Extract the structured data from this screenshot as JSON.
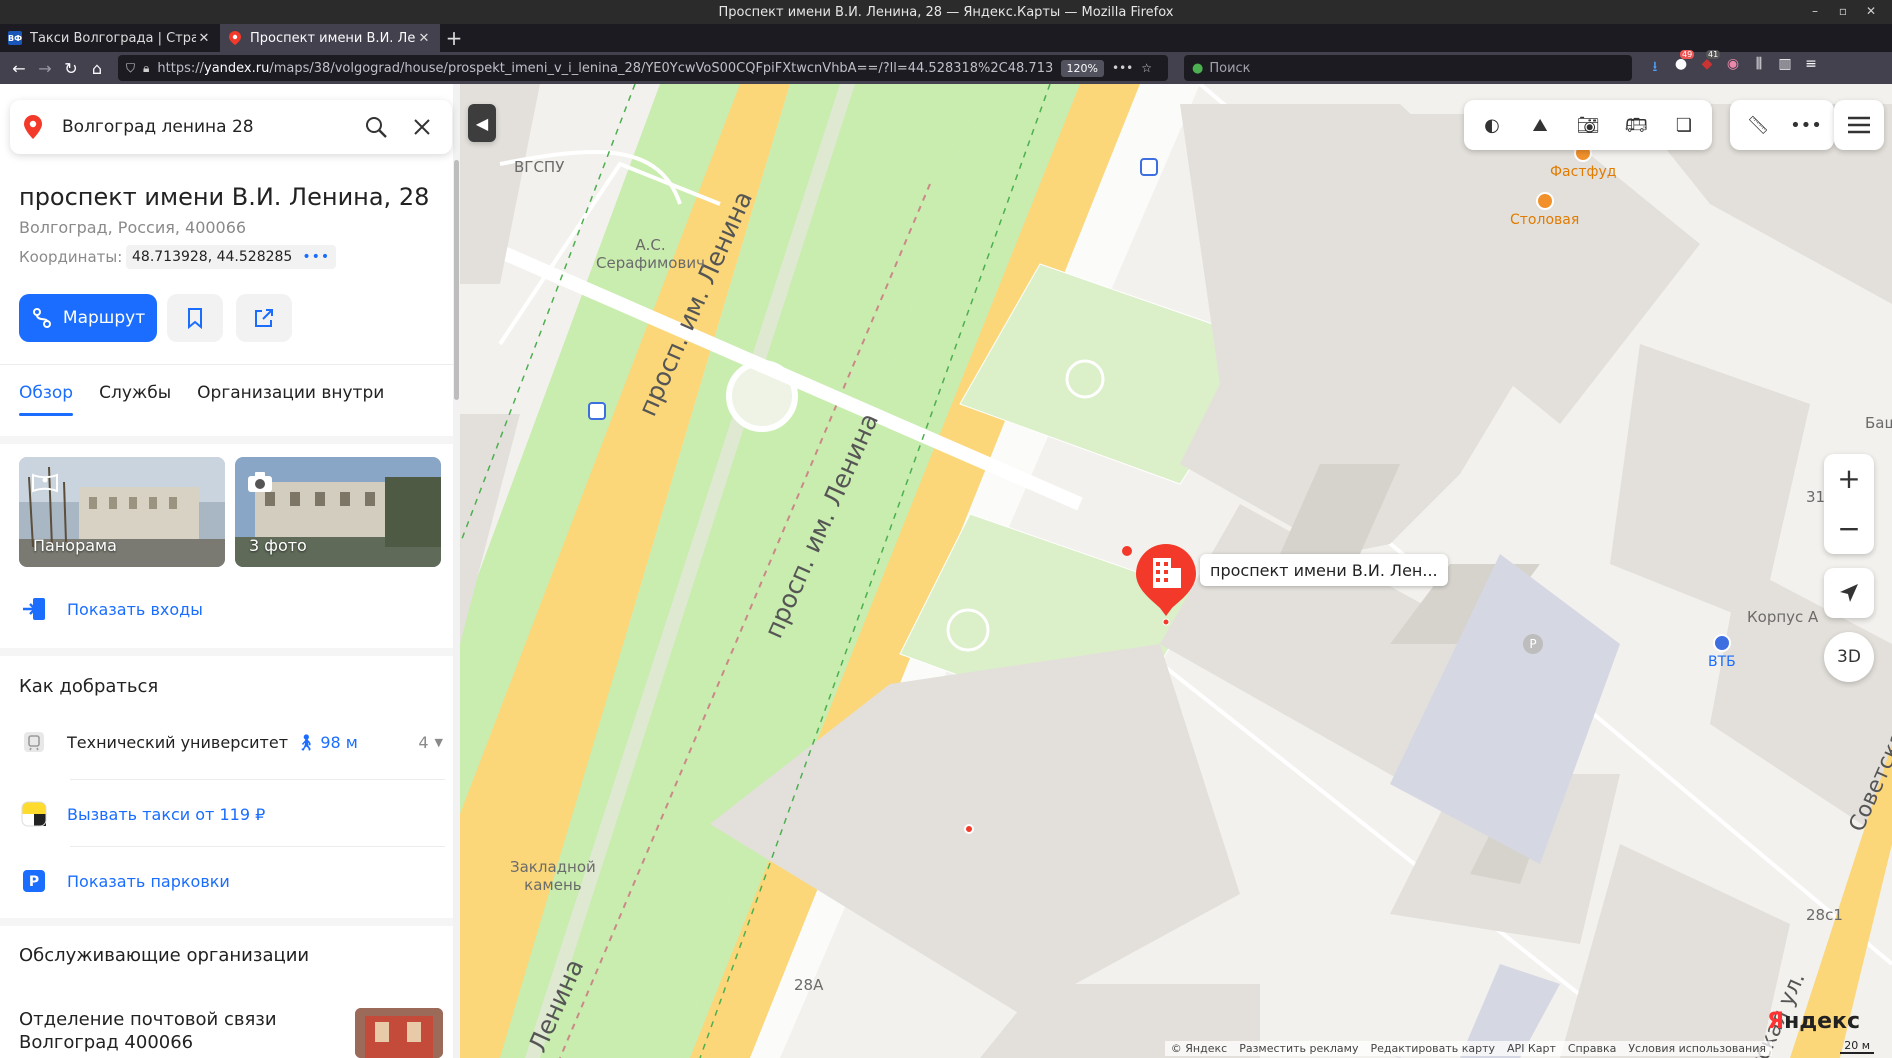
{
  "window": {
    "title": "Проспект имени В.И. Ленина, 28 — Яндекс.Карты — Mozilla Firefox"
  },
  "tabs": [
    {
      "label": "Такси Волгограда | Страни",
      "favicon": "ВФ"
    },
    {
      "label": "Проспект имени В.И. Лен",
      "favicon": ""
    }
  ],
  "nav": {
    "url_prefix": "https://",
    "url_host": "yandex.ru",
    "url_rest": "/maps/38/volgograd/house/prospekt_imeni_v_i_lenina_28/YE0YcwVoS00CQFpiFXtwcnVhbA==/?ll=44.528318%2C48.713",
    "zoom": "120%",
    "search_placeholder": "Поиск",
    "badge_1": "49",
    "badge_2": "41"
  },
  "sidebar": {
    "search_query": "Волгоград ленина 28",
    "place_title": "проспект имени В.И. Ленина, 28",
    "place_address": "Волгоград, Россия, 400066",
    "coords_label": "Координаты:",
    "coords_value": "48.713928, 44.528285",
    "route_button": "Маршрут",
    "tabs": [
      "Обзор",
      "Службы",
      "Организации внутри"
    ],
    "photos": [
      {
        "caption": "Панорама"
      },
      {
        "caption": "3 фото"
      }
    ],
    "show_entrances": "Показать входы",
    "how_to_get": "Как добраться",
    "transit_stop": "Технический университет",
    "transit_walk": "98 м",
    "transit_count": "4",
    "taxi": "Вызвать такси от 119 ₽",
    "parking": "Показать парковки",
    "service_orgs": "Обслуживающие организации",
    "org_name_line1": "Отделение почтовой связи",
    "org_name_line2": "Волгоград 400066"
  },
  "map": {
    "road_label_1": "просп. им. Ленина",
    "road_label_2": "просп. им. Ленина",
    "road_label_3": "Ленина",
    "road_label_4": "Советская",
    "road_label_5": "тская ул.",
    "label_vgspu": "ВГСПУ",
    "label_monument_1": "А.С.",
    "label_monument_2": "Серафимович",
    "label_stone_1": "Закладной",
    "label_stone_2": "камень",
    "label_fastfood": "Фастфуд",
    "label_canteen": "Столовая",
    "label_korpus": "Корпус А",
    "label_vtb": "ВТБ",
    "label_bash": "Баш",
    "label_31": "31",
    "label_28a": "28А",
    "label_28c1": "28с1",
    "pin_label": "проспект имени В.И. Лен...",
    "btn_3d": "3D",
    "logo": "Яндекс",
    "scale": "20 м",
    "footer": [
      "© Яндекс",
      "Разместить рекламу",
      "Редактировать карту",
      "API Карт",
      "Справка",
      "Условия использования"
    ]
  },
  "colors": {
    "accent": "#1a6dff",
    "pin_red": "#f33a2a",
    "road_yellow": "#fbd77a",
    "park_green": "#c9ecaf",
    "building": "#e3e0db"
  }
}
